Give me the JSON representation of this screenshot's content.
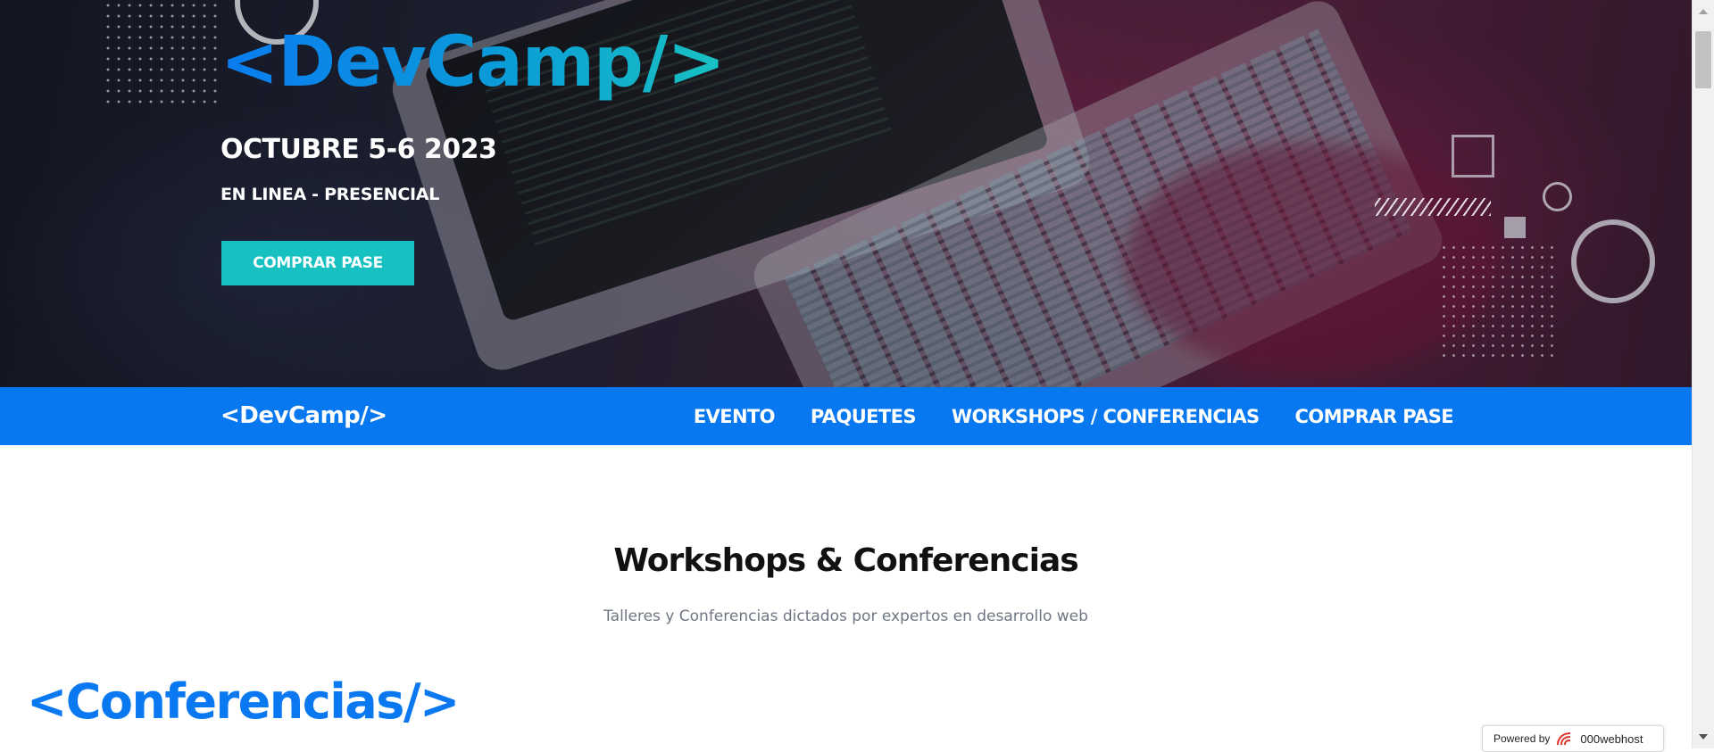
{
  "hero": {
    "logo": "<DevCamp/>",
    "date": "OCTUBRE 5-6 2023",
    "mode": "EN LINEA - PRESENCIAL",
    "cta_label": "COMPRAR PASE"
  },
  "nav": {
    "logo": "<DevCamp/>",
    "links": [
      {
        "label": "EVENTO"
      },
      {
        "label": "PAQUETES"
      },
      {
        "label": "WORKSHOPS / CONFERENCIAS"
      },
      {
        "label": "COMPRAR PASE"
      }
    ]
  },
  "section": {
    "title": "Workshops & Conferencias",
    "subtitle": "Talleres y Conferencias dictados por expertos en desarrollo web"
  },
  "conferences": {
    "heading": "<Conferencias/>"
  },
  "badge": {
    "prefix": "Powered by",
    "brand": "000webhost",
    "icon": "000webhost-logo-icon"
  },
  "colors": {
    "primary_blue": "#0878f0",
    "accent_teal": "#17c1c1",
    "title_dark": "#111111",
    "subtitle_gray": "#6f7683"
  }
}
